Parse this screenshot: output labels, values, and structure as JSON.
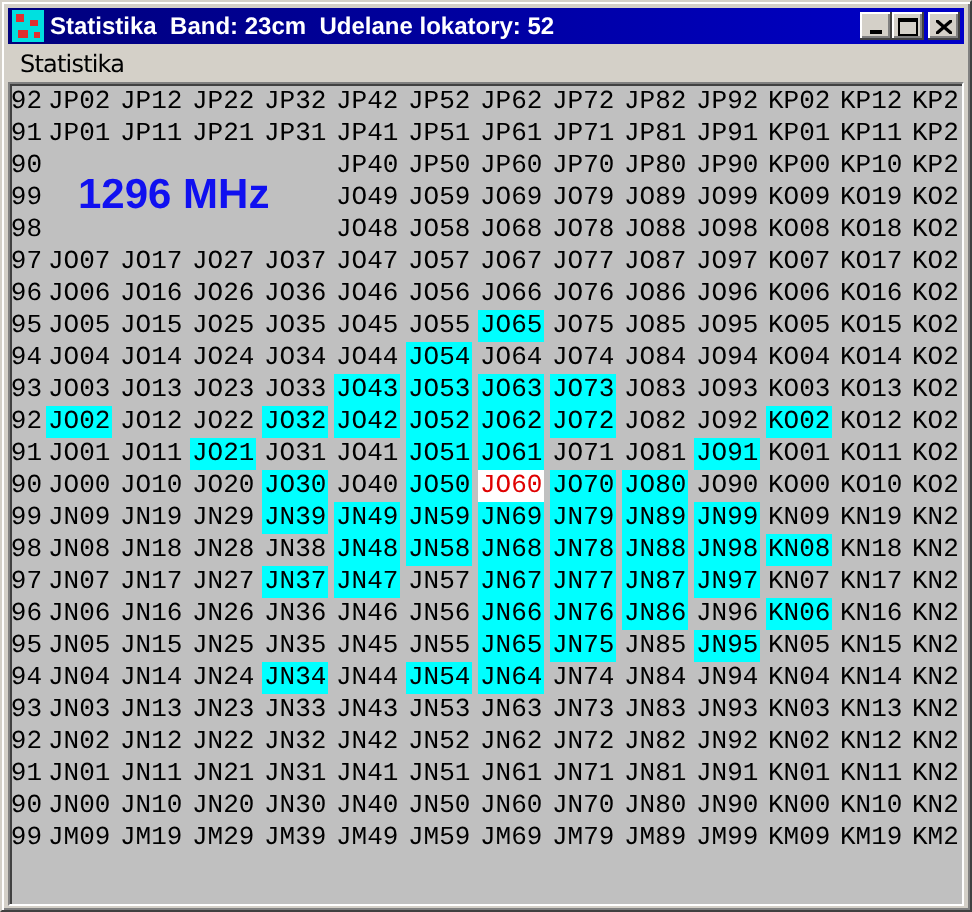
{
  "window": {
    "title": "Statistika  Band: 23cm  Udelane lokatory: 52"
  },
  "menu": [
    "Statistika"
  ],
  "band_label": "1296 MHz",
  "rows": [
    {
      "cells": [
        {
          "text": "92",
          "worked": false,
          "selected": false
        },
        {
          "text": "JP02",
          "worked": false,
          "selected": false
        },
        {
          "text": "JP12",
          "worked": false,
          "selected": false
        },
        {
          "text": "JP22",
          "worked": false,
          "selected": false
        },
        {
          "text": "JP32",
          "worked": false,
          "selected": false
        },
        {
          "text": "JP42",
          "worked": false,
          "selected": false
        },
        {
          "text": "JP52",
          "worked": false,
          "selected": false
        },
        {
          "text": "JP62",
          "worked": false,
          "selected": false
        },
        {
          "text": "JP72",
          "worked": false,
          "selected": false
        },
        {
          "text": "JP82",
          "worked": false,
          "selected": false
        },
        {
          "text": "JP92",
          "worked": false,
          "selected": false
        },
        {
          "text": "KP02",
          "worked": false,
          "selected": false
        },
        {
          "text": "KP12",
          "worked": false,
          "selected": false
        },
        {
          "text": "KP2",
          "worked": false,
          "selected": false
        }
      ]
    },
    {
      "cells": [
        {
          "text": "91",
          "worked": false,
          "selected": false
        },
        {
          "text": "JP01",
          "worked": false,
          "selected": false
        },
        {
          "text": "JP11",
          "worked": false,
          "selected": false
        },
        {
          "text": "JP21",
          "worked": false,
          "selected": false
        },
        {
          "text": "JP31",
          "worked": false,
          "selected": false
        },
        {
          "text": "JP41",
          "worked": false,
          "selected": false
        },
        {
          "text": "JP51",
          "worked": false,
          "selected": false
        },
        {
          "text": "JP61",
          "worked": false,
          "selected": false
        },
        {
          "text": "JP71",
          "worked": false,
          "selected": false
        },
        {
          "text": "JP81",
          "worked": false,
          "selected": false
        },
        {
          "text": "JP91",
          "worked": false,
          "selected": false
        },
        {
          "text": "KP01",
          "worked": false,
          "selected": false
        },
        {
          "text": "KP11",
          "worked": false,
          "selected": false
        },
        {
          "text": "KP2",
          "worked": false,
          "selected": false
        }
      ]
    },
    {
      "cells": [
        {
          "text": "90",
          "worked": false,
          "selected": false
        },
        null,
        null,
        null,
        null,
        {
          "text": "JP40",
          "worked": false,
          "selected": false
        },
        {
          "text": "JP50",
          "worked": false,
          "selected": false
        },
        {
          "text": "JP60",
          "worked": false,
          "selected": false
        },
        {
          "text": "JP70",
          "worked": false,
          "selected": false
        },
        {
          "text": "JP80",
          "worked": false,
          "selected": false
        },
        {
          "text": "JP90",
          "worked": false,
          "selected": false
        },
        {
          "text": "KP00",
          "worked": false,
          "selected": false
        },
        {
          "text": "KP10",
          "worked": false,
          "selected": false
        },
        {
          "text": "KP2",
          "worked": false,
          "selected": false
        }
      ]
    },
    {
      "cells": [
        {
          "text": "99",
          "worked": false,
          "selected": false
        },
        null,
        null,
        null,
        null,
        {
          "text": "JO49",
          "worked": false,
          "selected": false
        },
        {
          "text": "JO59",
          "worked": false,
          "selected": false
        },
        {
          "text": "JO69",
          "worked": false,
          "selected": false
        },
        {
          "text": "JO79",
          "worked": false,
          "selected": false
        },
        {
          "text": "JO89",
          "worked": false,
          "selected": false
        },
        {
          "text": "JO99",
          "worked": false,
          "selected": false
        },
        {
          "text": "KO09",
          "worked": false,
          "selected": false
        },
        {
          "text": "KO19",
          "worked": false,
          "selected": false
        },
        {
          "text": "KO2",
          "worked": false,
          "selected": false
        }
      ]
    },
    {
      "cells": [
        {
          "text": "98",
          "worked": false,
          "selected": false
        },
        null,
        null,
        null,
        null,
        {
          "text": "JO48",
          "worked": false,
          "selected": false
        },
        {
          "text": "JO58",
          "worked": false,
          "selected": false
        },
        {
          "text": "JO68",
          "worked": false,
          "selected": false
        },
        {
          "text": "JO78",
          "worked": false,
          "selected": false
        },
        {
          "text": "JO88",
          "worked": false,
          "selected": false
        },
        {
          "text": "JO98",
          "worked": false,
          "selected": false
        },
        {
          "text": "KO08",
          "worked": false,
          "selected": false
        },
        {
          "text": "KO18",
          "worked": false,
          "selected": false
        },
        {
          "text": "KO2",
          "worked": false,
          "selected": false
        }
      ]
    },
    {
      "cells": [
        {
          "text": "97",
          "worked": false,
          "selected": false
        },
        {
          "text": "JO07",
          "worked": false,
          "selected": false
        },
        {
          "text": "JO17",
          "worked": false,
          "selected": false
        },
        {
          "text": "JO27",
          "worked": false,
          "selected": false
        },
        {
          "text": "JO37",
          "worked": false,
          "selected": false
        },
        {
          "text": "JO47",
          "worked": false,
          "selected": false
        },
        {
          "text": "JO57",
          "worked": false,
          "selected": false
        },
        {
          "text": "JO67",
          "worked": false,
          "selected": false
        },
        {
          "text": "JO77",
          "worked": false,
          "selected": false
        },
        {
          "text": "JO87",
          "worked": false,
          "selected": false
        },
        {
          "text": "JO97",
          "worked": false,
          "selected": false
        },
        {
          "text": "KO07",
          "worked": false,
          "selected": false
        },
        {
          "text": "KO17",
          "worked": false,
          "selected": false
        },
        {
          "text": "KO2",
          "worked": false,
          "selected": false
        }
      ]
    },
    {
      "cells": [
        {
          "text": "96",
          "worked": false,
          "selected": false
        },
        {
          "text": "JO06",
          "worked": false,
          "selected": false
        },
        {
          "text": "JO16",
          "worked": false,
          "selected": false
        },
        {
          "text": "JO26",
          "worked": false,
          "selected": false
        },
        {
          "text": "JO36",
          "worked": false,
          "selected": false
        },
        {
          "text": "JO46",
          "worked": false,
          "selected": false
        },
        {
          "text": "JO56",
          "worked": false,
          "selected": false
        },
        {
          "text": "JO66",
          "worked": false,
          "selected": false
        },
        {
          "text": "JO76",
          "worked": false,
          "selected": false
        },
        {
          "text": "JO86",
          "worked": false,
          "selected": false
        },
        {
          "text": "JO96",
          "worked": false,
          "selected": false
        },
        {
          "text": "KO06",
          "worked": false,
          "selected": false
        },
        {
          "text": "KO16",
          "worked": false,
          "selected": false
        },
        {
          "text": "KO2",
          "worked": false,
          "selected": false
        }
      ]
    },
    {
      "cells": [
        {
          "text": "95",
          "worked": false,
          "selected": false
        },
        {
          "text": "JO05",
          "worked": false,
          "selected": false
        },
        {
          "text": "JO15",
          "worked": false,
          "selected": false
        },
        {
          "text": "JO25",
          "worked": false,
          "selected": false
        },
        {
          "text": "JO35",
          "worked": false,
          "selected": false
        },
        {
          "text": "JO45",
          "worked": false,
          "selected": false
        },
        {
          "text": "JO55",
          "worked": false,
          "selected": false
        },
        {
          "text": "JO65",
          "worked": true,
          "selected": false
        },
        {
          "text": "JO75",
          "worked": false,
          "selected": false
        },
        {
          "text": "JO85",
          "worked": false,
          "selected": false
        },
        {
          "text": "JO95",
          "worked": false,
          "selected": false
        },
        {
          "text": "KO05",
          "worked": false,
          "selected": false
        },
        {
          "text": "KO15",
          "worked": false,
          "selected": false
        },
        {
          "text": "KO2",
          "worked": false,
          "selected": false
        }
      ]
    },
    {
      "cells": [
        {
          "text": "94",
          "worked": false,
          "selected": false
        },
        {
          "text": "JO04",
          "worked": false,
          "selected": false
        },
        {
          "text": "JO14",
          "worked": false,
          "selected": false
        },
        {
          "text": "JO24",
          "worked": false,
          "selected": false
        },
        {
          "text": "JO34",
          "worked": false,
          "selected": false
        },
        {
          "text": "JO44",
          "worked": false,
          "selected": false
        },
        {
          "text": "JO54",
          "worked": true,
          "selected": false
        },
        {
          "text": "JO64",
          "worked": false,
          "selected": false
        },
        {
          "text": "JO74",
          "worked": false,
          "selected": false
        },
        {
          "text": "JO84",
          "worked": false,
          "selected": false
        },
        {
          "text": "JO94",
          "worked": false,
          "selected": false
        },
        {
          "text": "KO04",
          "worked": false,
          "selected": false
        },
        {
          "text": "KO14",
          "worked": false,
          "selected": false
        },
        {
          "text": "KO2",
          "worked": false,
          "selected": false
        }
      ]
    },
    {
      "cells": [
        {
          "text": "93",
          "worked": false,
          "selected": false
        },
        {
          "text": "JO03",
          "worked": false,
          "selected": false
        },
        {
          "text": "JO13",
          "worked": false,
          "selected": false
        },
        {
          "text": "JO23",
          "worked": false,
          "selected": false
        },
        {
          "text": "JO33",
          "worked": false,
          "selected": false
        },
        {
          "text": "JO43",
          "worked": true,
          "selected": false
        },
        {
          "text": "JO53",
          "worked": true,
          "selected": false
        },
        {
          "text": "JO63",
          "worked": true,
          "selected": false
        },
        {
          "text": "JO73",
          "worked": true,
          "selected": false
        },
        {
          "text": "JO83",
          "worked": false,
          "selected": false
        },
        {
          "text": "JO93",
          "worked": false,
          "selected": false
        },
        {
          "text": "KO03",
          "worked": false,
          "selected": false
        },
        {
          "text": "KO13",
          "worked": false,
          "selected": false
        },
        {
          "text": "KO2",
          "worked": false,
          "selected": false
        }
      ]
    },
    {
      "cells": [
        {
          "text": "92",
          "worked": false,
          "selected": false
        },
        {
          "text": "JO02",
          "worked": true,
          "selected": false
        },
        {
          "text": "JO12",
          "worked": false,
          "selected": false
        },
        {
          "text": "JO22",
          "worked": false,
          "selected": false
        },
        {
          "text": "JO32",
          "worked": true,
          "selected": false
        },
        {
          "text": "JO42",
          "worked": true,
          "selected": false
        },
        {
          "text": "JO52",
          "worked": true,
          "selected": false
        },
        {
          "text": "JO62",
          "worked": true,
          "selected": false
        },
        {
          "text": "JO72",
          "worked": true,
          "selected": false
        },
        {
          "text": "JO82",
          "worked": false,
          "selected": false
        },
        {
          "text": "JO92",
          "worked": false,
          "selected": false
        },
        {
          "text": "KO02",
          "worked": true,
          "selected": false
        },
        {
          "text": "KO12",
          "worked": false,
          "selected": false
        },
        {
          "text": "KO2",
          "worked": false,
          "selected": false
        }
      ]
    },
    {
      "cells": [
        {
          "text": "91",
          "worked": false,
          "selected": false
        },
        {
          "text": "JO01",
          "worked": false,
          "selected": false
        },
        {
          "text": "JO11",
          "worked": false,
          "selected": false
        },
        {
          "text": "JO21",
          "worked": true,
          "selected": false
        },
        {
          "text": "JO31",
          "worked": false,
          "selected": false
        },
        {
          "text": "JO41",
          "worked": false,
          "selected": false
        },
        {
          "text": "JO51",
          "worked": true,
          "selected": false
        },
        {
          "text": "JO61",
          "worked": true,
          "selected": false
        },
        {
          "text": "JO71",
          "worked": false,
          "selected": false
        },
        {
          "text": "JO81",
          "worked": false,
          "selected": false
        },
        {
          "text": "JO91",
          "worked": true,
          "selected": false
        },
        {
          "text": "KO01",
          "worked": false,
          "selected": false
        },
        {
          "text": "KO11",
          "worked": false,
          "selected": false
        },
        {
          "text": "KO2",
          "worked": false,
          "selected": false
        }
      ]
    },
    {
      "cells": [
        {
          "text": "90",
          "worked": false,
          "selected": false
        },
        {
          "text": "JO00",
          "worked": false,
          "selected": false
        },
        {
          "text": "JO10",
          "worked": false,
          "selected": false
        },
        {
          "text": "JO20",
          "worked": false,
          "selected": false
        },
        {
          "text": "JO30",
          "worked": true,
          "selected": false
        },
        {
          "text": "JO40",
          "worked": false,
          "selected": false
        },
        {
          "text": "JO50",
          "worked": true,
          "selected": false
        },
        {
          "text": "JO60",
          "worked": false,
          "selected": true
        },
        {
          "text": "JO70",
          "worked": true,
          "selected": false
        },
        {
          "text": "JO80",
          "worked": true,
          "selected": false
        },
        {
          "text": "JO90",
          "worked": false,
          "selected": false
        },
        {
          "text": "KO00",
          "worked": false,
          "selected": false
        },
        {
          "text": "KO10",
          "worked": false,
          "selected": false
        },
        {
          "text": "KO2",
          "worked": false,
          "selected": false
        }
      ]
    },
    {
      "cells": [
        {
          "text": "99",
          "worked": false,
          "selected": false
        },
        {
          "text": "JN09",
          "worked": false,
          "selected": false
        },
        {
          "text": "JN19",
          "worked": false,
          "selected": false
        },
        {
          "text": "JN29",
          "worked": false,
          "selected": false
        },
        {
          "text": "JN39",
          "worked": true,
          "selected": false
        },
        {
          "text": "JN49",
          "worked": true,
          "selected": false
        },
        {
          "text": "JN59",
          "worked": true,
          "selected": false
        },
        {
          "text": "JN69",
          "worked": true,
          "selected": false
        },
        {
          "text": "JN79",
          "worked": true,
          "selected": false
        },
        {
          "text": "JN89",
          "worked": true,
          "selected": false
        },
        {
          "text": "JN99",
          "worked": true,
          "selected": false
        },
        {
          "text": "KN09",
          "worked": false,
          "selected": false
        },
        {
          "text": "KN19",
          "worked": false,
          "selected": false
        },
        {
          "text": "KN2",
          "worked": false,
          "selected": false
        }
      ]
    },
    {
      "cells": [
        {
          "text": "98",
          "worked": false,
          "selected": false
        },
        {
          "text": "JN08",
          "worked": false,
          "selected": false
        },
        {
          "text": "JN18",
          "worked": false,
          "selected": false
        },
        {
          "text": "JN28",
          "worked": false,
          "selected": false
        },
        {
          "text": "JN38",
          "worked": false,
          "selected": false
        },
        {
          "text": "JN48",
          "worked": true,
          "selected": false
        },
        {
          "text": "JN58",
          "worked": true,
          "selected": false
        },
        {
          "text": "JN68",
          "worked": true,
          "selected": false
        },
        {
          "text": "JN78",
          "worked": true,
          "selected": false
        },
        {
          "text": "JN88",
          "worked": true,
          "selected": false
        },
        {
          "text": "JN98",
          "worked": true,
          "selected": false
        },
        {
          "text": "KN08",
          "worked": true,
          "selected": false
        },
        {
          "text": "KN18",
          "worked": false,
          "selected": false
        },
        {
          "text": "KN2",
          "worked": false,
          "selected": false
        }
      ]
    },
    {
      "cells": [
        {
          "text": "97",
          "worked": false,
          "selected": false
        },
        {
          "text": "JN07",
          "worked": false,
          "selected": false
        },
        {
          "text": "JN17",
          "worked": false,
          "selected": false
        },
        {
          "text": "JN27",
          "worked": false,
          "selected": false
        },
        {
          "text": "JN37",
          "worked": true,
          "selected": false
        },
        {
          "text": "JN47",
          "worked": true,
          "selected": false
        },
        {
          "text": "JN57",
          "worked": false,
          "selected": false
        },
        {
          "text": "JN67",
          "worked": true,
          "selected": false
        },
        {
          "text": "JN77",
          "worked": true,
          "selected": false
        },
        {
          "text": "JN87",
          "worked": true,
          "selected": false
        },
        {
          "text": "JN97",
          "worked": true,
          "selected": false
        },
        {
          "text": "KN07",
          "worked": false,
          "selected": false
        },
        {
          "text": "KN17",
          "worked": false,
          "selected": false
        },
        {
          "text": "KN2",
          "worked": false,
          "selected": false
        }
      ]
    },
    {
      "cells": [
        {
          "text": "96",
          "worked": false,
          "selected": false
        },
        {
          "text": "JN06",
          "worked": false,
          "selected": false
        },
        {
          "text": "JN16",
          "worked": false,
          "selected": false
        },
        {
          "text": "JN26",
          "worked": false,
          "selected": false
        },
        {
          "text": "JN36",
          "worked": false,
          "selected": false
        },
        {
          "text": "JN46",
          "worked": false,
          "selected": false
        },
        {
          "text": "JN56",
          "worked": false,
          "selected": false
        },
        {
          "text": "JN66",
          "worked": true,
          "selected": false
        },
        {
          "text": "JN76",
          "worked": true,
          "selected": false
        },
        {
          "text": "JN86",
          "worked": true,
          "selected": false
        },
        {
          "text": "JN96",
          "worked": false,
          "selected": false
        },
        {
          "text": "KN06",
          "worked": true,
          "selected": false
        },
        {
          "text": "KN16",
          "worked": false,
          "selected": false
        },
        {
          "text": "KN2",
          "worked": false,
          "selected": false
        }
      ]
    },
    {
      "cells": [
        {
          "text": "95",
          "worked": false,
          "selected": false
        },
        {
          "text": "JN05",
          "worked": false,
          "selected": false
        },
        {
          "text": "JN15",
          "worked": false,
          "selected": false
        },
        {
          "text": "JN25",
          "worked": false,
          "selected": false
        },
        {
          "text": "JN35",
          "worked": false,
          "selected": false
        },
        {
          "text": "JN45",
          "worked": false,
          "selected": false
        },
        {
          "text": "JN55",
          "worked": false,
          "selected": false
        },
        {
          "text": "JN65",
          "worked": true,
          "selected": false
        },
        {
          "text": "JN75",
          "worked": true,
          "selected": false
        },
        {
          "text": "JN85",
          "worked": false,
          "selected": false
        },
        {
          "text": "JN95",
          "worked": true,
          "selected": false
        },
        {
          "text": "KN05",
          "worked": false,
          "selected": false
        },
        {
          "text": "KN15",
          "worked": false,
          "selected": false
        },
        {
          "text": "KN2",
          "worked": false,
          "selected": false
        }
      ]
    },
    {
      "cells": [
        {
          "text": "94",
          "worked": false,
          "selected": false
        },
        {
          "text": "JN04",
          "worked": false,
          "selected": false
        },
        {
          "text": "JN14",
          "worked": false,
          "selected": false
        },
        {
          "text": "JN24",
          "worked": false,
          "selected": false
        },
        {
          "text": "JN34",
          "worked": true,
          "selected": false
        },
        {
          "text": "JN44",
          "worked": false,
          "selected": false
        },
        {
          "text": "JN54",
          "worked": true,
          "selected": false
        },
        {
          "text": "JN64",
          "worked": true,
          "selected": false
        },
        {
          "text": "JN74",
          "worked": false,
          "selected": false
        },
        {
          "text": "JN84",
          "worked": false,
          "selected": false
        },
        {
          "text": "JN94",
          "worked": false,
          "selected": false
        },
        {
          "text": "KN04",
          "worked": false,
          "selected": false
        },
        {
          "text": "KN14",
          "worked": false,
          "selected": false
        },
        {
          "text": "KN2",
          "worked": false,
          "selected": false
        }
      ]
    },
    {
      "cells": [
        {
          "text": "93",
          "worked": false,
          "selected": false
        },
        {
          "text": "JN03",
          "worked": false,
          "selected": false
        },
        {
          "text": "JN13",
          "worked": false,
          "selected": false
        },
        {
          "text": "JN23",
          "worked": false,
          "selected": false
        },
        {
          "text": "JN33",
          "worked": false,
          "selected": false
        },
        {
          "text": "JN43",
          "worked": false,
          "selected": false
        },
        {
          "text": "JN53",
          "worked": false,
          "selected": false
        },
        {
          "text": "JN63",
          "worked": false,
          "selected": false
        },
        {
          "text": "JN73",
          "worked": false,
          "selected": false
        },
        {
          "text": "JN83",
          "worked": false,
          "selected": false
        },
        {
          "text": "JN93",
          "worked": false,
          "selected": false
        },
        {
          "text": "KN03",
          "worked": false,
          "selected": false
        },
        {
          "text": "KN13",
          "worked": false,
          "selected": false
        },
        {
          "text": "KN2",
          "worked": false,
          "selected": false
        }
      ]
    },
    {
      "cells": [
        {
          "text": "92",
          "worked": false,
          "selected": false
        },
        {
          "text": "JN02",
          "worked": false,
          "selected": false
        },
        {
          "text": "JN12",
          "worked": false,
          "selected": false
        },
        {
          "text": "JN22",
          "worked": false,
          "selected": false
        },
        {
          "text": "JN32",
          "worked": false,
          "selected": false
        },
        {
          "text": "JN42",
          "worked": false,
          "selected": false
        },
        {
          "text": "JN52",
          "worked": false,
          "selected": false
        },
        {
          "text": "JN62",
          "worked": false,
          "selected": false
        },
        {
          "text": "JN72",
          "worked": false,
          "selected": false
        },
        {
          "text": "JN82",
          "worked": false,
          "selected": false
        },
        {
          "text": "JN92",
          "worked": false,
          "selected": false
        },
        {
          "text": "KN02",
          "worked": false,
          "selected": false
        },
        {
          "text": "KN12",
          "worked": false,
          "selected": false
        },
        {
          "text": "KN2",
          "worked": false,
          "selected": false
        }
      ]
    },
    {
      "cells": [
        {
          "text": "91",
          "worked": false,
          "selected": false
        },
        {
          "text": "JN01",
          "worked": false,
          "selected": false
        },
        {
          "text": "JN11",
          "worked": false,
          "selected": false
        },
        {
          "text": "JN21",
          "worked": false,
          "selected": false
        },
        {
          "text": "JN31",
          "worked": false,
          "selected": false
        },
        {
          "text": "JN41",
          "worked": false,
          "selected": false
        },
        {
          "text": "JN51",
          "worked": false,
          "selected": false
        },
        {
          "text": "JN61",
          "worked": false,
          "selected": false
        },
        {
          "text": "JN71",
          "worked": false,
          "selected": false
        },
        {
          "text": "JN81",
          "worked": false,
          "selected": false
        },
        {
          "text": "JN91",
          "worked": false,
          "selected": false
        },
        {
          "text": "KN01",
          "worked": false,
          "selected": false
        },
        {
          "text": "KN11",
          "worked": false,
          "selected": false
        },
        {
          "text": "KN2",
          "worked": false,
          "selected": false
        }
      ]
    },
    {
      "cells": [
        {
          "text": "90",
          "worked": false,
          "selected": false
        },
        {
          "text": "JN00",
          "worked": false,
          "selected": false
        },
        {
          "text": "JN10",
          "worked": false,
          "selected": false
        },
        {
          "text": "JN20",
          "worked": false,
          "selected": false
        },
        {
          "text": "JN30",
          "worked": false,
          "selected": false
        },
        {
          "text": "JN40",
          "worked": false,
          "selected": false
        },
        {
          "text": "JN50",
          "worked": false,
          "selected": false
        },
        {
          "text": "JN60",
          "worked": false,
          "selected": false
        },
        {
          "text": "JN70",
          "worked": false,
          "selected": false
        },
        {
          "text": "JN80",
          "worked": false,
          "selected": false
        },
        {
          "text": "JN90",
          "worked": false,
          "selected": false
        },
        {
          "text": "KN00",
          "worked": false,
          "selected": false
        },
        {
          "text": "KN10",
          "worked": false,
          "selected": false
        },
        {
          "text": "KN2",
          "worked": false,
          "selected": false
        }
      ]
    },
    {
      "cells": [
        {
          "text": "99",
          "worked": false,
          "selected": false
        },
        {
          "text": "JM09",
          "worked": false,
          "selected": false
        },
        {
          "text": "JM19",
          "worked": false,
          "selected": false
        },
        {
          "text": "JM29",
          "worked": false,
          "selected": false
        },
        {
          "text": "JM39",
          "worked": false,
          "selected": false
        },
        {
          "text": "JM49",
          "worked": false,
          "selected": false
        },
        {
          "text": "JM59",
          "worked": false,
          "selected": false
        },
        {
          "text": "JM69",
          "worked": false,
          "selected": false
        },
        {
          "text": "JM79",
          "worked": false,
          "selected": false
        },
        {
          "text": "JM89",
          "worked": false,
          "selected": false
        },
        {
          "text": "JM99",
          "worked": false,
          "selected": false
        },
        {
          "text": "KM09",
          "worked": false,
          "selected": false
        },
        {
          "text": "KM19",
          "worked": false,
          "selected": false
        },
        {
          "text": "KM2",
          "worked": false,
          "selected": false
        }
      ]
    }
  ]
}
